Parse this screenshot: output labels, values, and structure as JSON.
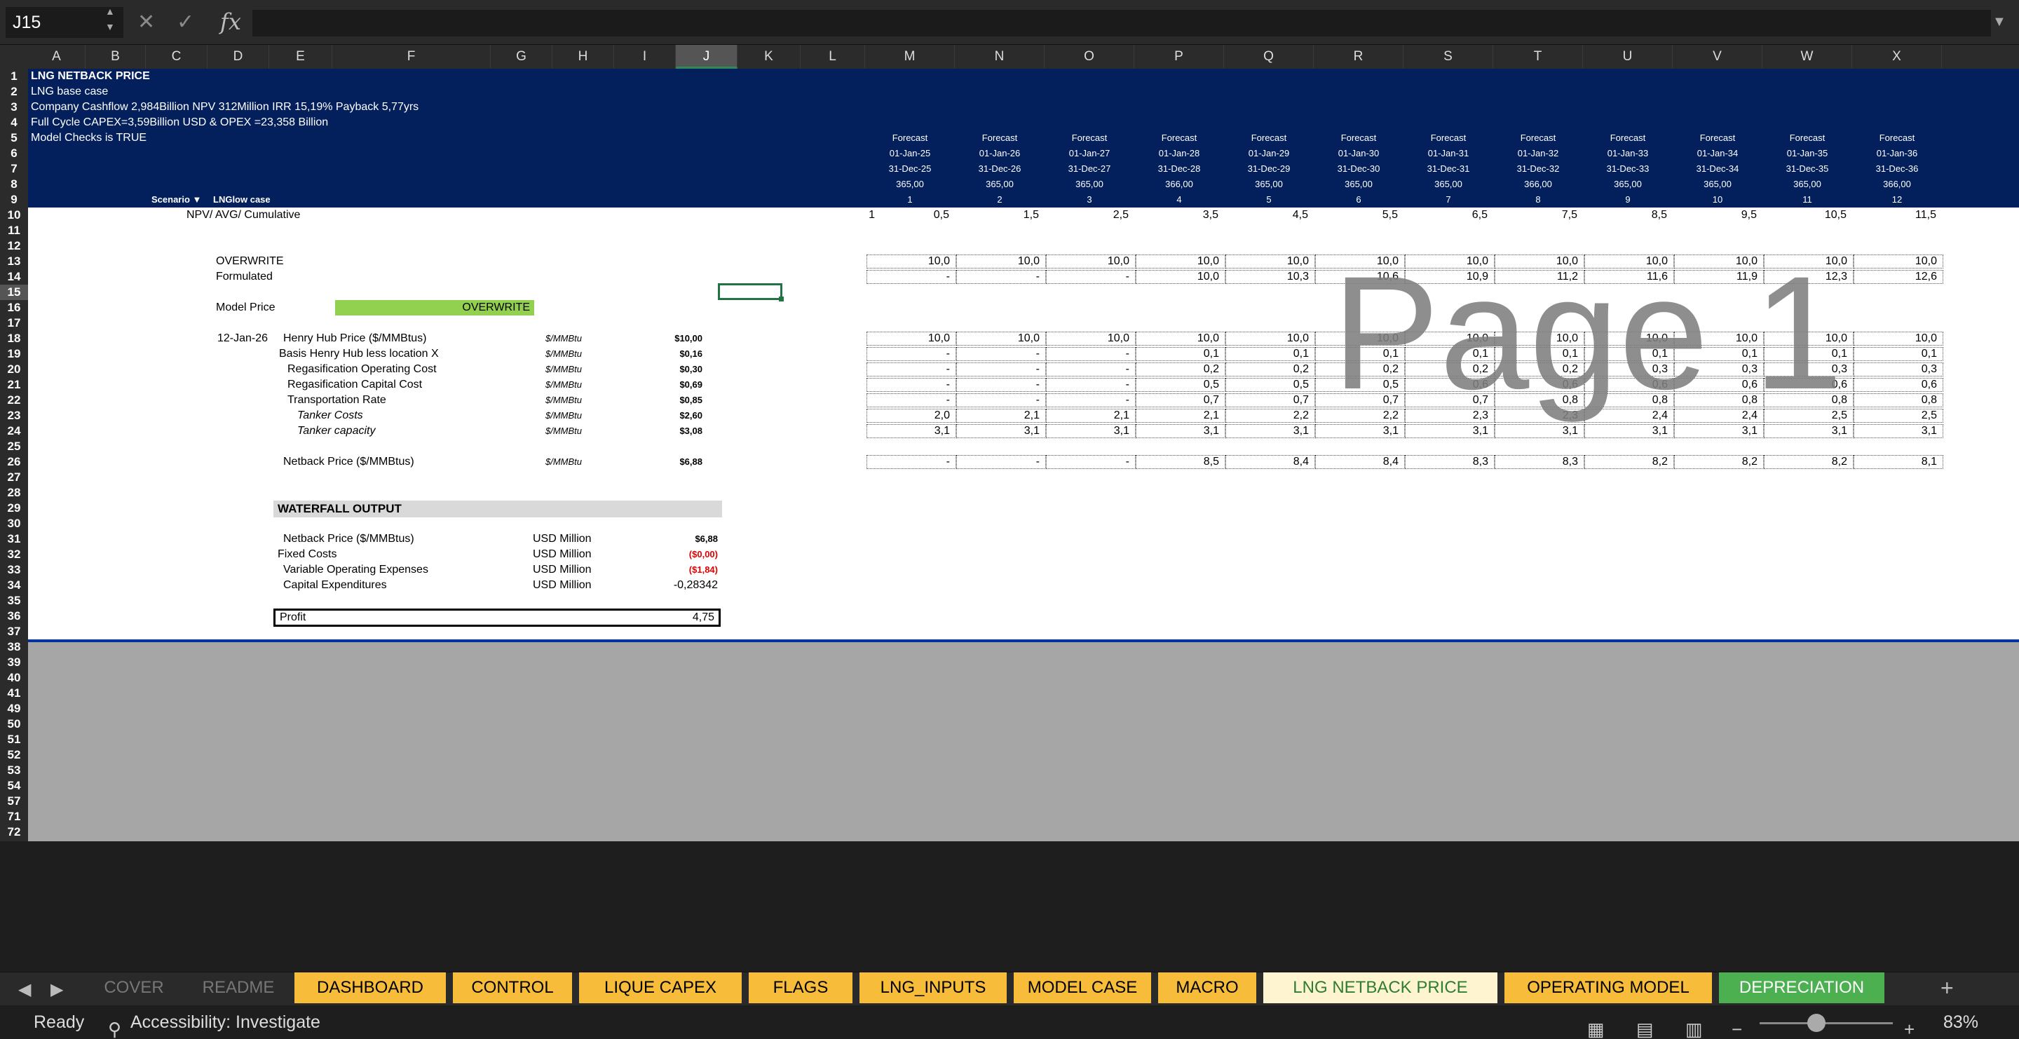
{
  "formula_bar": {
    "cell_ref": "J15",
    "formula": ""
  },
  "columns": [
    "A",
    "B",
    "C",
    "D",
    "E",
    "F",
    "G",
    "H",
    "I",
    "J",
    "K",
    "L",
    "M",
    "N",
    "O",
    "P",
    "Q",
    "R",
    "S",
    "T",
    "U",
    "V",
    "W",
    "X"
  ],
  "rows": [
    "1",
    "2",
    "3",
    "4",
    "5",
    "6",
    "7",
    "8",
    "9",
    "10",
    "11",
    "12",
    "13",
    "14",
    "15",
    "16",
    "17",
    "18",
    "19",
    "20",
    "21",
    "22",
    "23",
    "24",
    "25",
    "26",
    "27",
    "28",
    "29",
    "30",
    "31",
    "32",
    "33",
    "34",
    "35",
    "36",
    "37",
    "38",
    "39",
    "40",
    "41",
    "49",
    "50",
    "51",
    "52",
    "53",
    "54",
    "57",
    "71",
    "72"
  ],
  "header": {
    "title": "LNG NETBACK PRICE",
    "case": "LNG base case",
    "cashflow": "Company Cashflow   2,984Billion  NPV 312Million  IRR 15,19% Payback 5,77yrs",
    "capex": "Full Cycle CAPEX=3,59Billion USD & OPEX =23,358 Billion",
    "checks": "Model Checks is TRUE",
    "scenario_label": "Scenario",
    "scenario_value": "LNGlow case",
    "npv_label": "NPV/  AVG/ Cumulative",
    "npv_value": "1"
  },
  "timeline": {
    "forecast": [
      "Forecast",
      "Forecast",
      "Forecast",
      "Forecast",
      "Forecast",
      "Forecast",
      "Forecast",
      "Forecast",
      "Forecast",
      "Forecast",
      "Forecast",
      "Forecast"
    ],
    "start": [
      "01-Jan-25",
      "01-Jan-26",
      "01-Jan-27",
      "01-Jan-28",
      "01-Jan-29",
      "01-Jan-30",
      "01-Jan-31",
      "01-Jan-32",
      "01-Jan-33",
      "01-Jan-34",
      "01-Jan-35",
      "01-Jan-36"
    ],
    "end": [
      "31-Dec-25",
      "31-Dec-26",
      "31-Dec-27",
      "31-Dec-28",
      "31-Dec-29",
      "31-Dec-30",
      "31-Dec-31",
      "31-Dec-32",
      "31-Dec-33",
      "31-Dec-34",
      "31-Dec-35",
      "31-Dec-36"
    ],
    "days": [
      "365,00",
      "365,00",
      "365,00",
      "366,00",
      "365,00",
      "365,00",
      "365,00",
      "366,00",
      "365,00",
      "365,00",
      "365,00",
      "366,00"
    ],
    "period": [
      "1",
      "2",
      "3",
      "4",
      "5",
      "6",
      "7",
      "8",
      "9",
      "10",
      "11",
      "12"
    ],
    "mid": [
      "0,5",
      "1,5",
      "2,5",
      "3,5",
      "4,5",
      "5,5",
      "6,5",
      "7,5",
      "8,5",
      "9,5",
      "10,5",
      "11,5"
    ]
  },
  "price_mode": {
    "overwrite_label": "OVERWRITE",
    "formulated_label": "Formulated",
    "overwrite": [
      "10,0",
      "10,0",
      "10,0",
      "10,0",
      "10,0",
      "10,0",
      "10,0",
      "10,0",
      "10,0",
      "10,0",
      "10,0",
      "10,0"
    ],
    "formulated": [
      "-",
      "-",
      "-",
      "10,0",
      "10,3",
      "10,6",
      "10,9",
      "11,2",
      "11,6",
      "11,9",
      "12,3",
      "12,6"
    ],
    "model_price_label": "Model Price",
    "model_price_value": "OVERWRITE"
  },
  "price_date": "12-Jan-26",
  "price_rows": [
    {
      "label": "Henry Hub Price ($/MMBtus)",
      "unit": "$/MMBtu",
      "value": "$10,00",
      "series": [
        "10,0",
        "10,0",
        "10,0",
        "10,0",
        "10,0",
        "10,0",
        "10,0",
        "10,0",
        "10,0",
        "10,0",
        "10,0",
        "10,0"
      ]
    },
    {
      "label": "Basis Henry Hub less location X",
      "unit": "$/MMBtu",
      "value": "$0,16",
      "series": [
        "-",
        "-",
        "-",
        "0,1",
        "0,1",
        "0,1",
        "0,1",
        "0,1",
        "0,1",
        "0,1",
        "0,1",
        "0,1"
      ]
    },
    {
      "label": "Regasification Operating Cost",
      "unit": "$/MMBtu",
      "value": "$0,30",
      "series": [
        "-",
        "-",
        "-",
        "0,2",
        "0,2",
        "0,2",
        "0,2",
        "0,2",
        "0,3",
        "0,3",
        "0,3",
        "0,3"
      ]
    },
    {
      "label": "Regasification Capital Cost",
      "unit": "$/MMBtu",
      "value": "$0,69",
      "series": [
        "-",
        "-",
        "-",
        "0,5",
        "0,5",
        "0,5",
        "0,6",
        "0,6",
        "0,6",
        "0,6",
        "0,6",
        "0,6"
      ]
    },
    {
      "label": "Transportation Rate",
      "unit": "$/MMBtu",
      "value": "$0,85",
      "series": [
        "-",
        "-",
        "-",
        "0,7",
        "0,7",
        "0,7",
        "0,7",
        "0,8",
        "0,8",
        "0,8",
        "0,8",
        "0,8"
      ]
    },
    {
      "label": "Tanker Costs",
      "unit": "$/MMBtu",
      "value": "$2,60",
      "series": [
        "2,0",
        "2,1",
        "2,1",
        "2,1",
        "2,2",
        "2,2",
        "2,3",
        "2,3",
        "2,4",
        "2,4",
        "2,5",
        "2,5"
      ]
    },
    {
      "label": "Tanker capacity",
      "unit": "$/MMBtu",
      "value": "$3,08",
      "series": [
        "3,1",
        "3,1",
        "3,1",
        "3,1",
        "3,1",
        "3,1",
        "3,1",
        "3,1",
        "3,1",
        "3,1",
        "3,1",
        "3,1"
      ]
    }
  ],
  "netback": {
    "label": "Netback Price ($/MMBtus)",
    "unit": "$/MMBtu",
    "value": "$6,88",
    "series": [
      "-",
      "-",
      "-",
      "8,5",
      "8,4",
      "8,4",
      "8,3",
      "8,3",
      "8,2",
      "8,2",
      "8,2",
      "8,1"
    ]
  },
  "waterfall": {
    "title": "WATERFALL  OUTPUT",
    "rows": [
      {
        "label": "Netback Price ($/MMBtus)",
        "unit": "USD Million",
        "value": "$6,88"
      },
      {
        "label": "Fixed Costs",
        "unit": "USD Million",
        "value": "($0,00)"
      },
      {
        "label": "Variable Operating Expenses",
        "unit": "USD Million",
        "value": "($1,84)"
      },
      {
        "label": "Capital Expenditures",
        "unit": "USD Million",
        "value": "-0,28342"
      }
    ],
    "profit_label": "Profit",
    "profit_value": "4,75"
  },
  "watermark": "Page 1",
  "tabs": [
    "COVER",
    "README",
    "DASHBOARD",
    "CONTROL",
    "LIQUE CAPEX",
    "FLAGS",
    "LNG_INPUTS",
    "MODEL CASE",
    "MACRO",
    "LNG NETBACK PRICE",
    "OPERATING MODEL",
    "DEPRECIATION"
  ],
  "status": {
    "ready": "Ready",
    "accessibility": "Accessibility: Investigate",
    "zoom": "83%"
  },
  "icons": {
    "cancel": "x-icon",
    "confirm": "check-icon",
    "function": "fx-icon"
  }
}
